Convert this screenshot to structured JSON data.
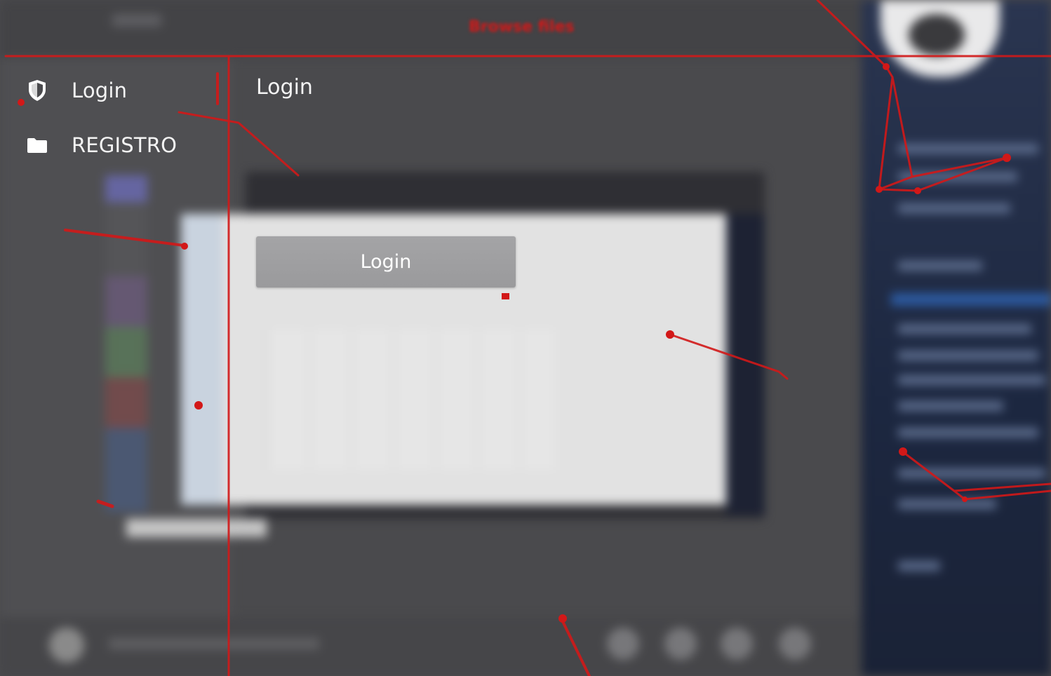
{
  "overlay": {
    "label": "Browse files",
    "color": "#d21818"
  },
  "nav": {
    "items": [
      {
        "label": "Login",
        "icon": "shield-icon"
      },
      {
        "label": "REGISTRO",
        "icon": "folder-icon"
      }
    ]
  },
  "main": {
    "title": "Login",
    "login_button_label": "Login"
  },
  "colors": {
    "background": "#4a4a4d",
    "button": "#a0a0a2",
    "text": "#f4f4f4",
    "right_panel": "#1c2740"
  }
}
